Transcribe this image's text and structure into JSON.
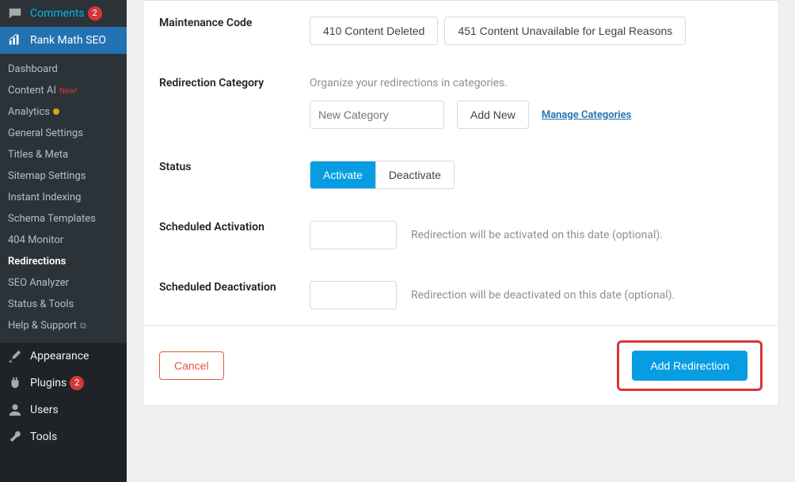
{
  "sidebar": {
    "comments": {
      "label": "Comments",
      "badge": "2"
    },
    "rankmath": {
      "label": "Rank Math SEO"
    },
    "submenu": [
      {
        "label": "Dashboard"
      },
      {
        "label": "Content AI",
        "new": "New!"
      },
      {
        "label": "Analytics",
        "dot": true
      },
      {
        "label": "General Settings"
      },
      {
        "label": "Titles & Meta"
      },
      {
        "label": "Sitemap Settings"
      },
      {
        "label": "Instant Indexing"
      },
      {
        "label": "Schema Templates"
      },
      {
        "label": "404 Monitor"
      },
      {
        "label": "Redirections",
        "current": true
      },
      {
        "label": "SEO Analyzer"
      },
      {
        "label": "Status & Tools"
      },
      {
        "label": "Help & Support",
        "ext": true
      }
    ],
    "appearance": {
      "label": "Appearance"
    },
    "plugins": {
      "label": "Plugins",
      "badge": "2"
    },
    "users": {
      "label": "Users"
    },
    "tools": {
      "label": "Tools"
    }
  },
  "form": {
    "maintenance": {
      "label": "Maintenance Code",
      "btn410": "410 Content Deleted",
      "btn451": "451 Content Unavailable for Legal Reasons"
    },
    "category": {
      "label": "Redirection Category",
      "help": "Organize your redirections in categories.",
      "placeholder": "New Category",
      "addnew": "Add New",
      "manage": "Manage Categories"
    },
    "status": {
      "label": "Status",
      "activate": "Activate",
      "deactivate": "Deactivate"
    },
    "sched_act": {
      "label": "Scheduled Activation",
      "help": "Redirection will be activated on this date (optional)."
    },
    "sched_deact": {
      "label": "Scheduled Deactivation",
      "help": "Redirection will be deactivated on this date (optional)."
    },
    "footer": {
      "cancel": "Cancel",
      "submit": "Add Redirection"
    }
  }
}
